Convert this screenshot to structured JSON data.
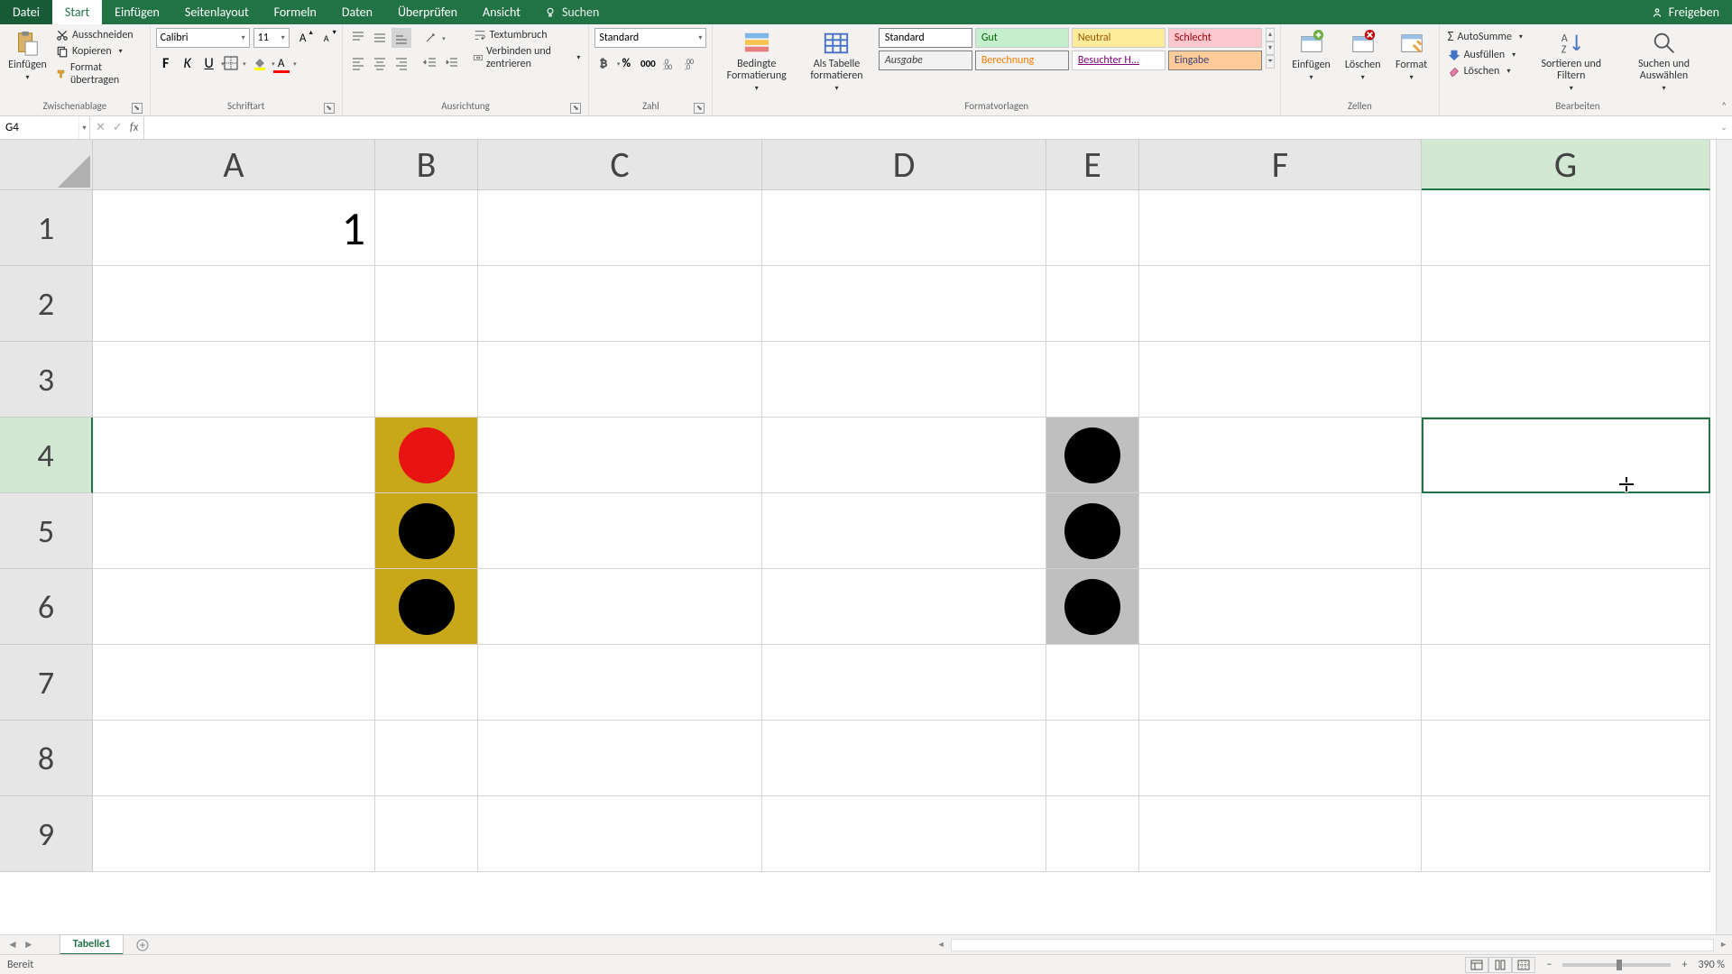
{
  "titlebar": {
    "tabs": [
      "Datei",
      "Start",
      "Einfügen",
      "Seitenlayout",
      "Formeln",
      "Daten",
      "Überprüfen",
      "Ansicht"
    ],
    "active_tab": "Start",
    "search": "Suchen",
    "share": "Freigeben"
  },
  "ribbon": {
    "clipboard": {
      "paste": "Einfügen",
      "cut": "Ausschneiden",
      "copy": "Kopieren",
      "format_painter": "Format übertragen",
      "label": "Zwischenablage"
    },
    "font": {
      "name": "Calibri",
      "size": "11",
      "bold": "F",
      "italic": "K",
      "underline": "U",
      "label": "Schriftart"
    },
    "alignment": {
      "wrap": "Textumbruch",
      "merge": "Verbinden und zentrieren",
      "label": "Ausrichtung"
    },
    "number": {
      "format": "Standard",
      "label": "Zahl"
    },
    "styles": {
      "cond": "Bedingte Formatierung",
      "table": "Als Tabelle formatieren",
      "grid": [
        {
          "text": "Standard",
          "bg": "#ffffff",
          "color": "#000",
          "border": "#808080"
        },
        {
          "text": "Gut",
          "bg": "#c6efce",
          "color": "#006100"
        },
        {
          "text": "Neutral",
          "bg": "#ffeb9c",
          "color": "#9c5700"
        },
        {
          "text": "Schlecht",
          "bg": "#ffc7ce",
          "color": "#9c0006"
        },
        {
          "text": "Ausgabe",
          "bg": "#f2f2f2",
          "color": "#3f3f3f",
          "italic": true,
          "border": "#808080"
        },
        {
          "text": "Berechnung",
          "bg": "#f2f2f2",
          "color": "#fa7d00",
          "border": "#808080"
        },
        {
          "text": "Besuchter H...",
          "bg": "#ffffff",
          "color": "#800080",
          "underline": true
        },
        {
          "text": "Eingabe",
          "bg": "#ffcc99",
          "color": "#3f3f76",
          "border": "#808080"
        }
      ],
      "label": "Formatvorlagen"
    },
    "cells": {
      "insert": "Einfügen",
      "delete": "Löschen",
      "format": "Format",
      "label": "Zellen"
    },
    "editing": {
      "autosum": "AutoSumme",
      "fill": "Ausfüllen",
      "clear": "Löschen",
      "sort": "Sortieren und Filtern",
      "find": "Suchen und Auswählen",
      "label": "Bearbeiten"
    }
  },
  "formula_bar": {
    "cell_ref": "G4",
    "formula": ""
  },
  "grid": {
    "columns": [
      "A",
      "B",
      "C",
      "D",
      "E",
      "F",
      "G"
    ],
    "rows": [
      "1",
      "2",
      "3",
      "4",
      "5",
      "6",
      "7",
      "8",
      "9"
    ],
    "selected_col": "G",
    "selected_row": "4",
    "cells": {
      "A1": "1"
    }
  },
  "sheet_tabs": {
    "active": "Tabelle1"
  },
  "status": {
    "ready": "Bereit",
    "zoom": "390 %"
  },
  "colors": {
    "accent": "#217346"
  }
}
